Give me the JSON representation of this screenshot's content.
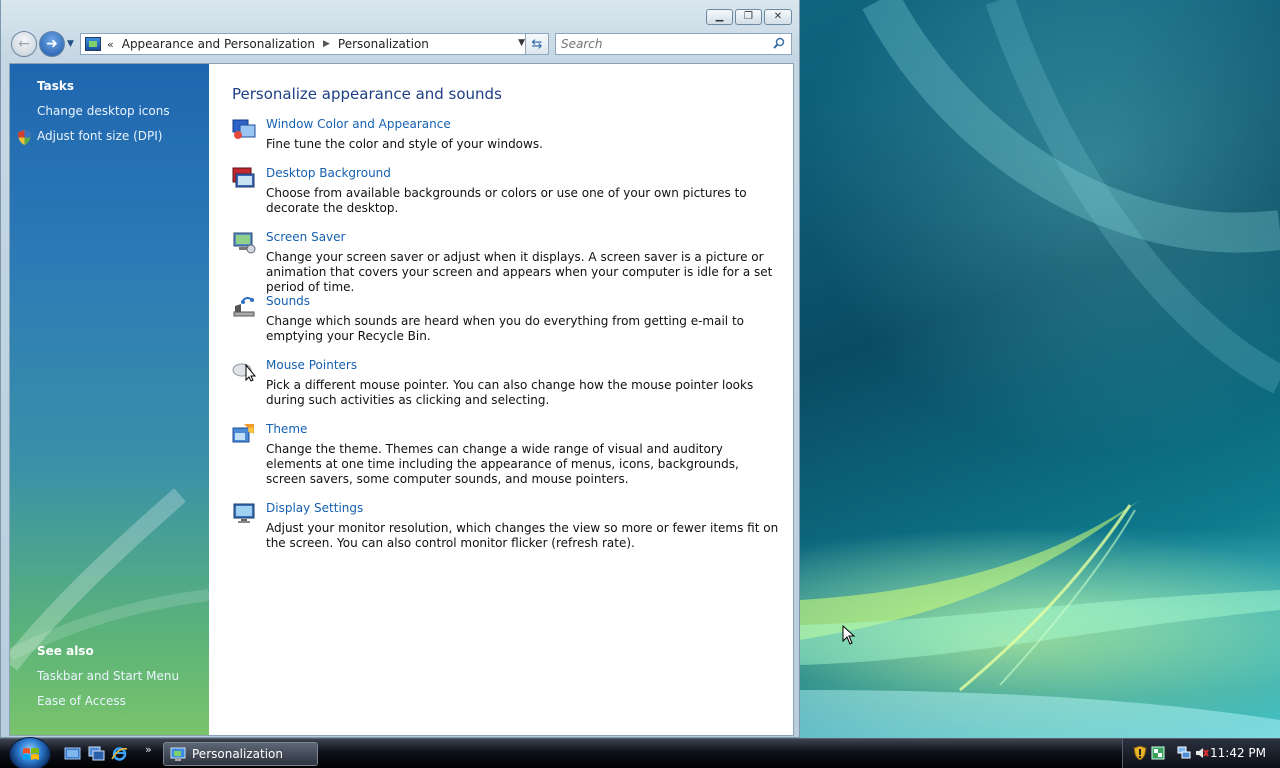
{
  "window": {
    "caption_buttons": {
      "minimize_icon": "minimize-icon",
      "maximize_icon": "restore-icon",
      "close_icon": "close-icon"
    },
    "address_bar": {
      "overflow_chevron": "«",
      "crumbs": [
        "Appearance and Personalization",
        "Personalization"
      ],
      "dropdown_icon": "chevron-down-icon"
    },
    "search": {
      "placeholder": "Search"
    }
  },
  "sidebar": {
    "tasks_heading": "Tasks",
    "tasks": [
      "Change desktop icons",
      "Adjust font size (DPI)"
    ],
    "see_also_heading": "See also",
    "see_also": [
      "Taskbar and Start Menu",
      "Ease of Access"
    ]
  },
  "main": {
    "heading": "Personalize appearance and sounds",
    "items": [
      {
        "title": "Window Color and Appearance",
        "desc": "Fine tune the color and style of your windows.",
        "icon": "window-color-icon"
      },
      {
        "title": "Desktop Background",
        "desc": "Choose from available backgrounds or colors or use one of your own pictures to decorate the desktop.",
        "icon": "desktop-background-icon"
      },
      {
        "title": "Screen Saver",
        "desc": "Change your screen saver or adjust when it displays. A screen saver is a picture or animation that covers your screen and appears when your computer is idle for a set period of time.",
        "icon": "screen-saver-icon"
      },
      {
        "title": "Sounds",
        "desc": "Change which sounds are heard when you do everything from getting e-mail to emptying your Recycle Bin.",
        "icon": "sounds-icon"
      },
      {
        "title": "Mouse Pointers",
        "desc": "Pick a different mouse pointer. You can also change how the mouse pointer looks during such activities as clicking and selecting.",
        "icon": "mouse-pointer-icon"
      },
      {
        "title": "Theme",
        "desc": "Change the theme. Themes can change a wide range of visual and auditory elements at one time including the appearance of menus, icons, backgrounds, screen savers, some computer sounds, and mouse pointers.",
        "icon": "theme-icon"
      },
      {
        "title": "Display Settings",
        "desc": "Adjust your monitor resolution, which changes the view so more or fewer items fit on the screen. You can also control monitor flicker (refresh rate).",
        "icon": "display-settings-icon"
      }
    ]
  },
  "taskbar": {
    "task_label": "Personalization",
    "quick_launch_more": "»",
    "clock": "11:42 PM"
  },
  "colors": {
    "link": "#1560b0",
    "heading": "#1e3f84",
    "sidebar_top": "#1f66b0",
    "sidebar_bottom": "#79c46b"
  }
}
